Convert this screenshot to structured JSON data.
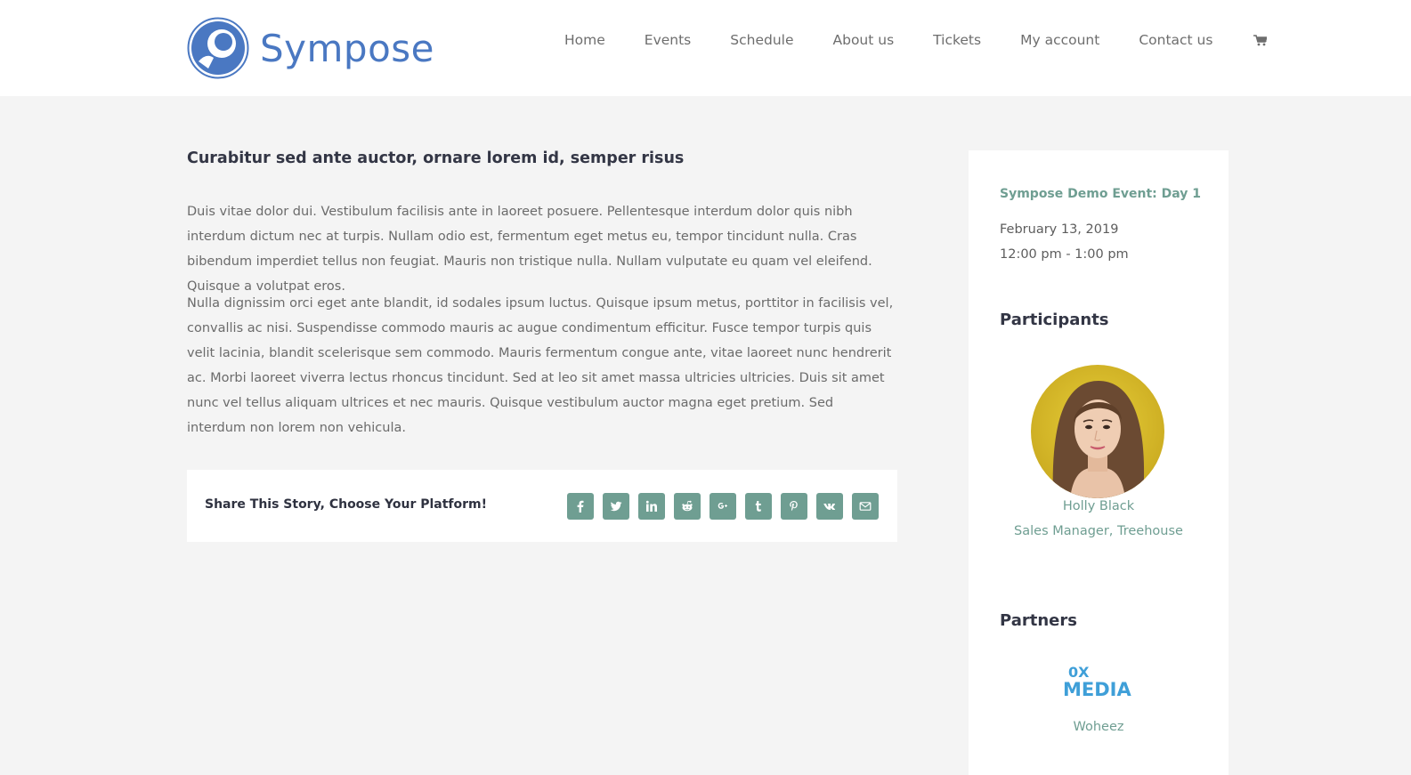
{
  "brand": {
    "name": "Sympose",
    "color": "#4a78c2"
  },
  "nav": {
    "items": [
      "Home",
      "Events",
      "Schedule",
      "About us",
      "Tickets",
      "My account",
      "Contact us"
    ],
    "cart_icon": "shopping-cart-icon"
  },
  "post": {
    "title": "Curabitur sed ante auctor, ornare lorem id, semper risus",
    "paragraphs": [
      "Duis vitae dolor dui. Vestibulum facilisis ante in laoreet posuere. Pellentesque interdum dolor quis nibh interdum dictum nec at turpis. Nullam odio est, fermentum eget metus eu, tempor tincidunt nulla. Cras bibendum imperdiet tellus non feugiat. Mauris non tristique nulla. Nullam vulputate eu quam vel eleifend. Quisque a volutpat eros.",
      "Nulla dignissim orci eget ante blandit, id sodales ipsum luctus. Quisque ipsum metus, porttitor in facilisis vel, convallis ac nisi. Suspendisse commodo mauris ac augue condimentum efficitur. Fusce tempor turpis quis velit lacinia, blandit scelerisque sem commodo. Mauris fermentum congue ante, vitae laoreet nunc hendrerit ac. Morbi laoreet viverra lectus rhoncus tincidunt. Sed at leo sit amet massa ultricies ultricies. Duis sit amet nunc vel tellus aliquam ultrices et nec mauris. Quisque vestibulum auctor magna eget pretium. Sed interdum non lorem non vehicula."
    ]
  },
  "share": {
    "label": "Share This Story, Choose Your Platform!",
    "accent": "#6f9e92",
    "icons": [
      "facebook-icon",
      "twitter-icon",
      "linkedin-icon",
      "reddit-icon",
      "google-plus-icon",
      "tumblr-icon",
      "pinterest-icon",
      "vk-icon",
      "email-icon"
    ]
  },
  "sidebar": {
    "event": {
      "title": "Sympose Demo Event: Day 1",
      "date": "February 13, 2019",
      "time": "12:00 pm - 1:00 pm"
    },
    "participants_heading": "Participants",
    "participant": {
      "name": "Holly Black",
      "role": "Sales Manager, Treehouse"
    },
    "partners_heading": "Partners",
    "partner": {
      "logo_text": "0X MEDIA",
      "name": "Woheez"
    }
  }
}
